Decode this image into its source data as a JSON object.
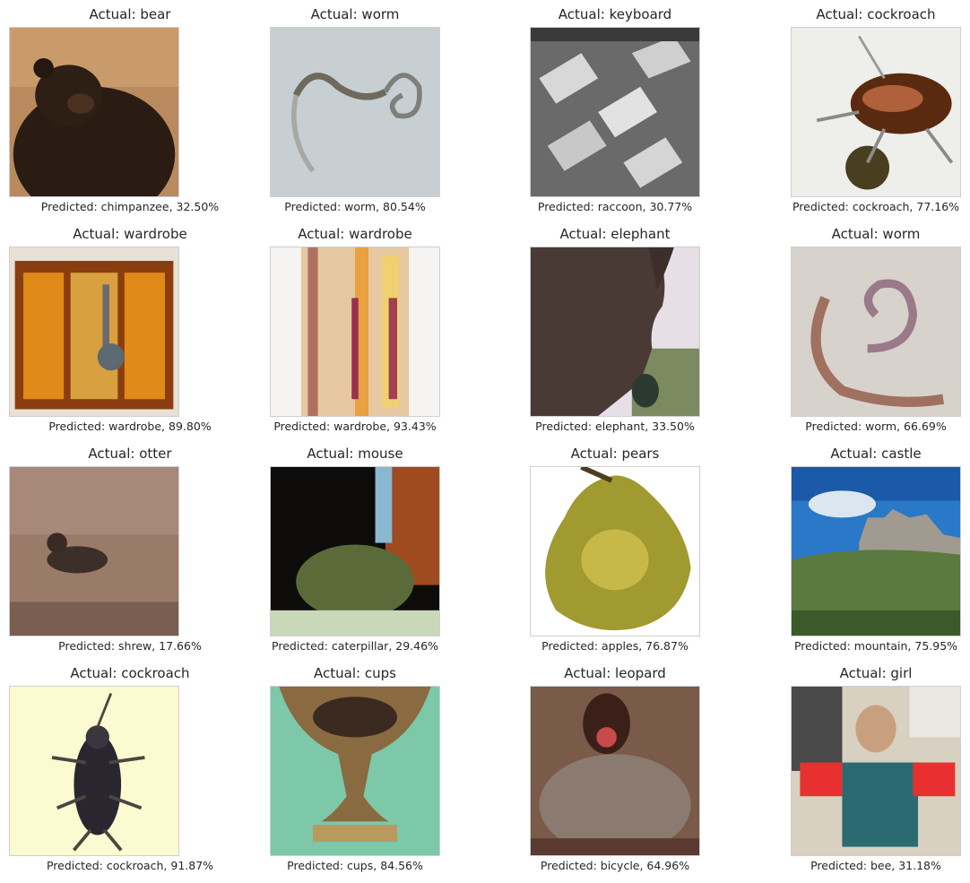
{
  "panels": [
    {
      "actual": "Actual: bear",
      "predicted": "Predicted: chimpanzee, 32.50%",
      "thumb": "bear"
    },
    {
      "actual": "Actual: worm",
      "predicted": "Predicted: worm, 80.54%",
      "thumb": "worm"
    },
    {
      "actual": "Actual: keyboard",
      "predicted": "Predicted: raccoon, 30.77%",
      "thumb": "keyboard"
    },
    {
      "actual": "Actual: cockroach",
      "predicted": "Predicted: cockroach, 77.16%",
      "thumb": "cockroach"
    },
    {
      "actual": "Actual: wardrobe",
      "predicted": "Predicted: wardrobe, 89.80%",
      "thumb": "wardrobe"
    },
    {
      "actual": "Actual: wardrobe",
      "predicted": "Predicted: wardrobe, 93.43%",
      "thumb": "wardrobe"
    },
    {
      "actual": "Actual: elephant",
      "predicted": "Predicted: elephant, 33.50%",
      "thumb": "elephant"
    },
    {
      "actual": "Actual: worm",
      "predicted": "Predicted: worm, 66.69%",
      "thumb": "worm"
    },
    {
      "actual": "Actual: otter",
      "predicted": "Predicted: shrew, 17.66%",
      "thumb": "otter"
    },
    {
      "actual": "Actual: mouse",
      "predicted": "Predicted: caterpillar, 29.46%",
      "thumb": "mouse"
    },
    {
      "actual": "Actual: pears",
      "predicted": "Predicted: apples, 76.87%",
      "thumb": "pear"
    },
    {
      "actual": "Actual: castle",
      "predicted": "Predicted: mountain, 75.95%",
      "thumb": "castle"
    },
    {
      "actual": "Actual: cockroach",
      "predicted": "Predicted: cockroach, 91.87%",
      "thumb": "cockroach"
    },
    {
      "actual": "Actual: cups",
      "predicted": "Predicted: cups, 84.56%",
      "thumb": "cup"
    },
    {
      "actual": "Actual: leopard",
      "predicted": "Predicted: bicycle, 64.96%",
      "thumb": "leopard"
    },
    {
      "actual": "Actual: girl",
      "predicted": "Predicted: bee, 31.18%",
      "thumb": "girl"
    }
  ]
}
